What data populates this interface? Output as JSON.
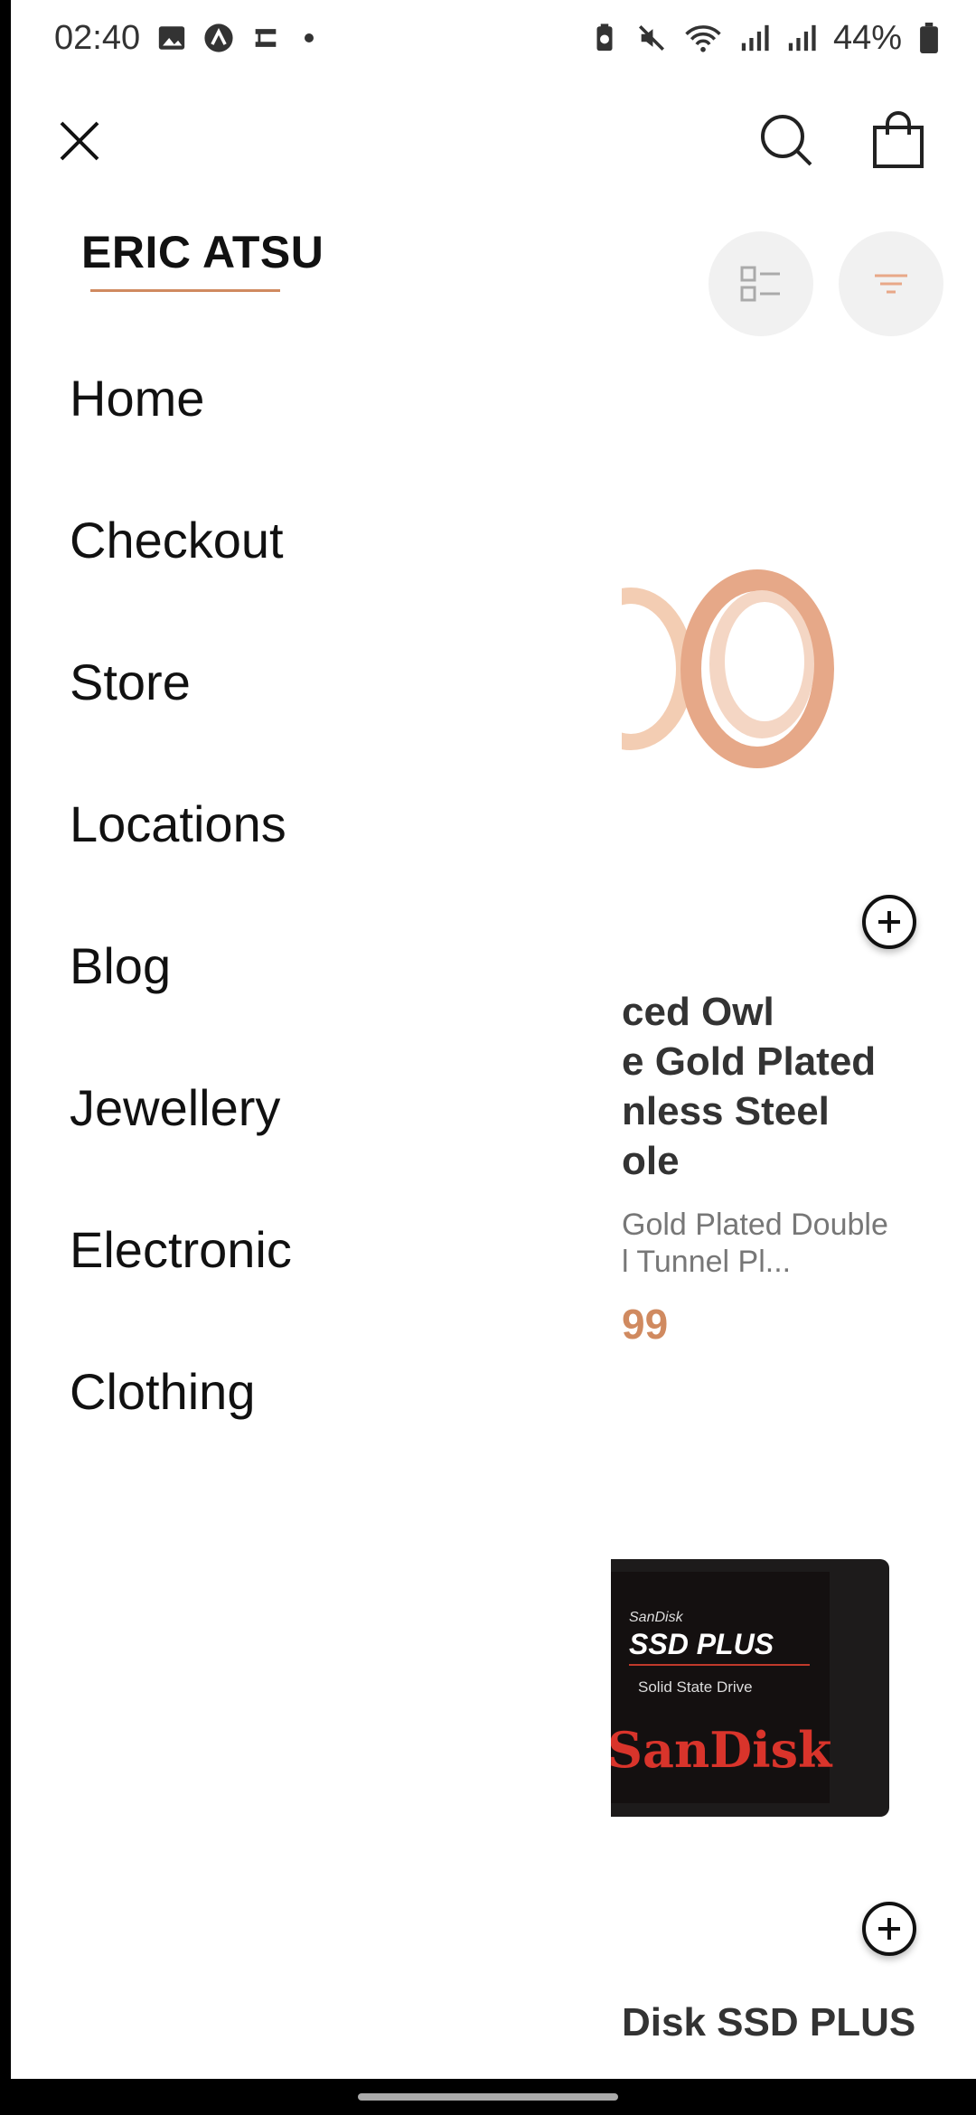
{
  "status_bar": {
    "time": "02:40",
    "battery": "44%"
  },
  "drawer": {
    "brand": "ERIC ATSU",
    "menu": [
      {
        "label": "Home"
      },
      {
        "label": "Checkout"
      },
      {
        "label": "Store"
      },
      {
        "label": "Locations"
      },
      {
        "label": "Blog"
      },
      {
        "label": "Jewellery"
      },
      {
        "label": "Electronic"
      },
      {
        "label": "Clothing"
      }
    ]
  },
  "products": [
    {
      "title_lines": [
        "ced Owl",
        "e Gold Plated",
        "nless Steel",
        "ole"
      ],
      "desc_lines": [
        "Gold Plated Double",
        "l Tunnel Pl..."
      ],
      "price": "99"
    },
    {
      "title_lines": [
        "Disk SSD PLUS"
      ],
      "image_text": {
        "brand_small": "SanDisk",
        "model": "SSD PLUS",
        "subtitle": "Solid State Drive",
        "logo": "SanDisk"
      }
    }
  ],
  "icons": {
    "close": "close-icon",
    "search": "search-icon",
    "bag": "shopping-bag-icon",
    "list_view": "list-view-icon",
    "filter": "filter-icon",
    "add": "add-circle-icon"
  },
  "colors": {
    "accent": "#d08a60",
    "text": "#111111"
  }
}
